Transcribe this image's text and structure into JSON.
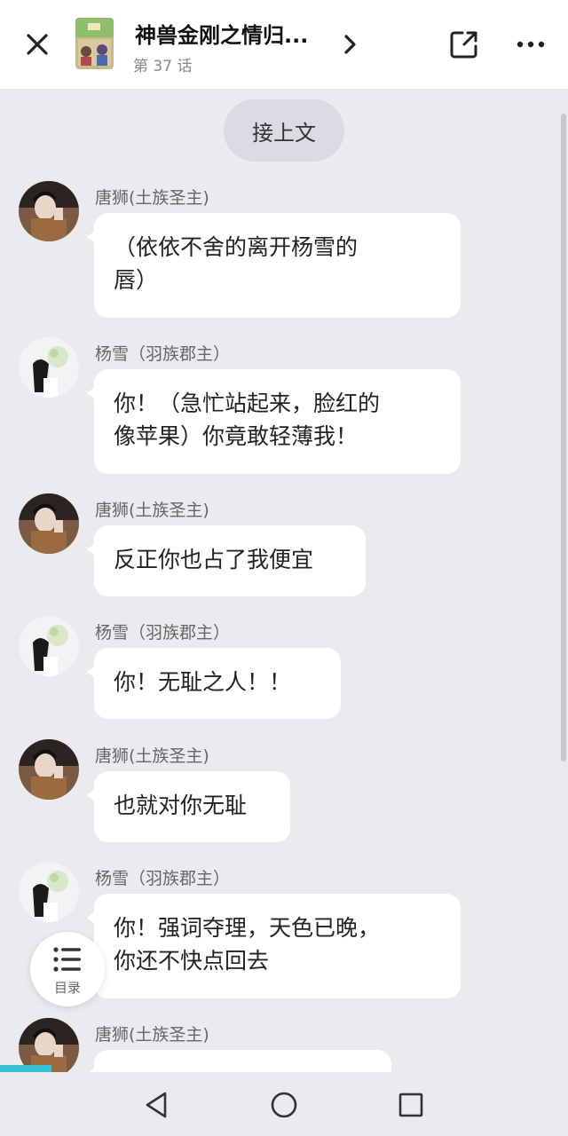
{
  "header": {
    "title": "神兽金刚之情归...",
    "episode": "第 37 话"
  },
  "continue_label": "接上文",
  "messages": [
    {
      "speaker": "唐狮(土族圣主)",
      "avatar": "tangshi",
      "lines": [
        "（依依不舍的离开杨雪的",
        "唇）"
      ]
    },
    {
      "speaker": "杨雪（羽族郡主）",
      "avatar": "yangxue",
      "lines": [
        "你！（急忙站起来，脸红的",
        "像苹果）你竟敢轻薄我！"
      ]
    },
    {
      "speaker": "唐狮(土族圣主)",
      "avatar": "tangshi",
      "lines": [
        "反正你也占了我便宜"
      ]
    },
    {
      "speaker": "杨雪（羽族郡主）",
      "avatar": "yangxue",
      "lines": [
        "你！无耻之人！！"
      ]
    },
    {
      "speaker": "唐狮(土族圣主)",
      "avatar": "tangshi",
      "lines": [
        "也就对你无耻"
      ]
    },
    {
      "speaker": "杨雪（羽族郡主）",
      "avatar": "yangxue",
      "lines": [
        "你！强词夺理，天色已晚，",
        "你还不快点回去"
      ]
    },
    {
      "speaker": "唐狮(土族圣主)",
      "avatar": "tangshi",
      "lines": [
        ""
      ]
    }
  ],
  "toc": {
    "label": "目录"
  },
  "icons": {
    "close": "close-icon",
    "share": "share-icon",
    "more": "more-icon",
    "chevron": "chevron-right-icon",
    "toc": "list-icon",
    "back": "nav-back-icon",
    "home": "nav-home-icon",
    "recent": "nav-recent-icon"
  },
  "colors": {
    "background": "#ebebef",
    "bubble": "#ffffff",
    "accent": "#35c3d5"
  }
}
